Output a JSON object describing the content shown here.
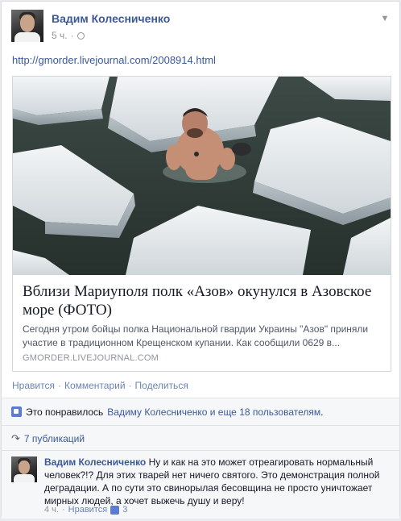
{
  "post": {
    "author": "Вадим Колесниченко",
    "time": "5 ч.",
    "link_text": "http://gmorder.livejournal.com/2008914.html"
  },
  "share": {
    "title": "Вблизи Мариуполя полк «Азов» окунулся в Азовское море (ФОТО)",
    "description": "Сегодня утром бойцы полка Национальной гвардии Украины \"Азов\" приняли участие в традиционном Крещенском купании. Как сообщили 0629 в...",
    "domain": "GMORDER.LIVEJOURNAL.COM"
  },
  "actions": {
    "like": "Нравится",
    "comment": "Комментарий",
    "share": "Поделиться",
    "separator": "·"
  },
  "likes": {
    "prefix": "Это понравилось",
    "names": "Вадиму Колесниченко и еще 18 пользователям",
    "suffix": "."
  },
  "shares": {
    "label": "7 публикаций"
  },
  "comment": {
    "author": "Вадим Колесниченко",
    "text": "Ну и как на это может отреагировать нормальный человек?!? Для этих тварей нет ничего святого. Это демонстрация полной деградации. А по сути это свинорылая бесовщина не просто уничтожает мирных людей, а хочет выжечь душу и веру!",
    "time": "4 ч.",
    "like": "Нравится",
    "like_count": "3"
  },
  "icons": {
    "globe": "globe-icon",
    "chevron": "chevron-down-icon",
    "thumb": "thumbs-up-icon",
    "share": "share-arrow-icon"
  },
  "colors": {
    "link": "#3b5998",
    "muted": "#90949c",
    "accent": "#5b7bd5"
  }
}
